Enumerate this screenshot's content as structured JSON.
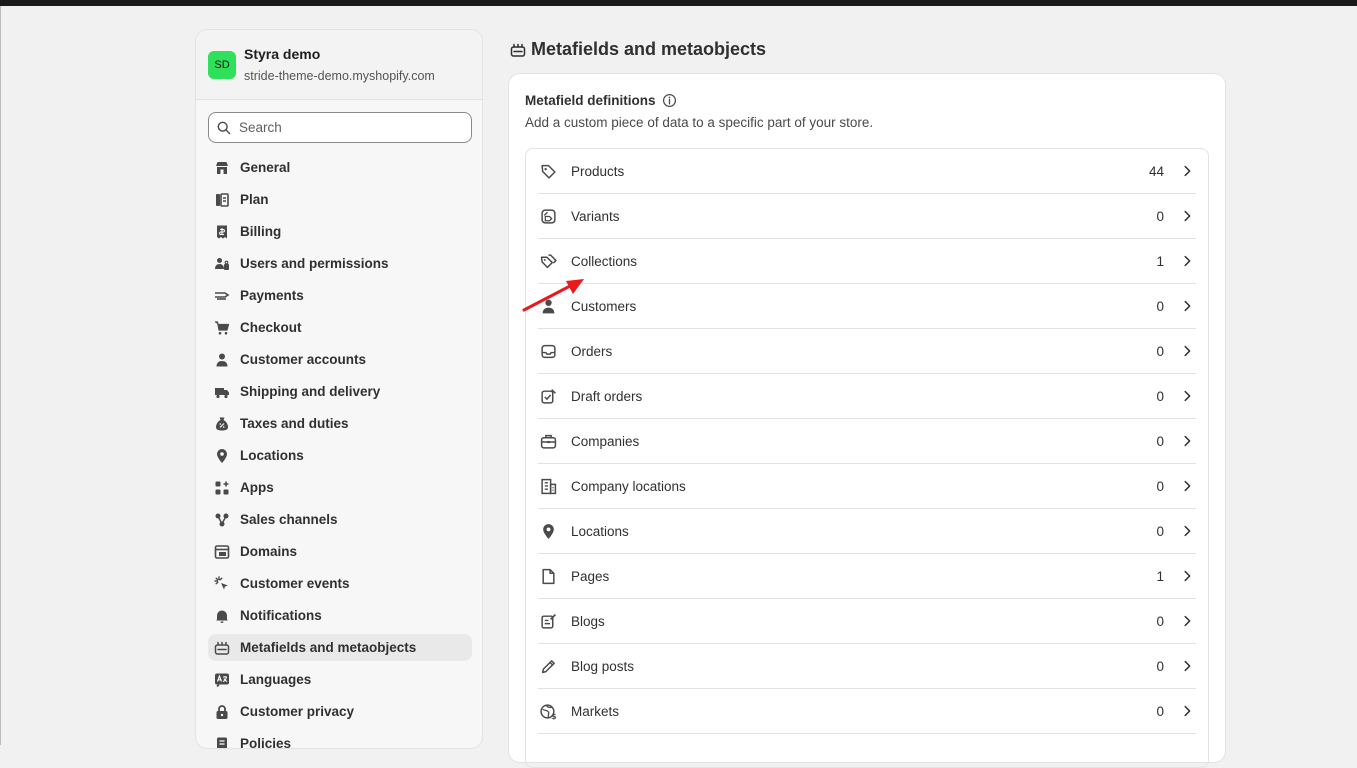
{
  "store": {
    "initials": "SD",
    "name": "Styra demo",
    "domain": "stride-theme-demo.myshopify.com",
    "avatar_color": "#2ee05a"
  },
  "search": {
    "placeholder": "Search",
    "value": ""
  },
  "sidebar": {
    "items": [
      {
        "label": "General",
        "icon": "store-icon"
      },
      {
        "label": "Plan",
        "icon": "plan-icon"
      },
      {
        "label": "Billing",
        "icon": "billing-icon"
      },
      {
        "label": "Users and permissions",
        "icon": "users-icon"
      },
      {
        "label": "Payments",
        "icon": "payments-icon"
      },
      {
        "label": "Checkout",
        "icon": "cart-icon"
      },
      {
        "label": "Customer accounts",
        "icon": "person-icon"
      },
      {
        "label": "Shipping and delivery",
        "icon": "truck-icon"
      },
      {
        "label": "Taxes and duties",
        "icon": "tax-icon"
      },
      {
        "label": "Locations",
        "icon": "location-pin-icon"
      },
      {
        "label": "Apps",
        "icon": "apps-icon"
      },
      {
        "label": "Sales channels",
        "icon": "sales-channels-icon"
      },
      {
        "label": "Domains",
        "icon": "domains-icon"
      },
      {
        "label": "Customer events",
        "icon": "cursor-click-icon"
      },
      {
        "label": "Notifications",
        "icon": "bell-icon"
      },
      {
        "label": "Metafields and metaobjects",
        "icon": "metafields-icon",
        "active": true
      },
      {
        "label": "Languages",
        "icon": "languages-icon"
      },
      {
        "label": "Customer privacy",
        "icon": "lock-icon"
      },
      {
        "label": "Policies",
        "icon": "policies-icon"
      }
    ]
  },
  "main": {
    "title": "Metafields and metaobjects",
    "card": {
      "heading": "Metafield definitions",
      "description": "Add a custom piece of data to a specific part of your store.",
      "rows": [
        {
          "label": "Products",
          "count": "44",
          "icon": "tag-icon"
        },
        {
          "label": "Variants",
          "count": "0",
          "icon": "variant-icon"
        },
        {
          "label": "Collections",
          "count": "1",
          "icon": "collection-icon"
        },
        {
          "label": "Customers",
          "count": "0",
          "icon": "person-icon"
        },
        {
          "label": "Orders",
          "count": "0",
          "icon": "inbox-icon"
        },
        {
          "label": "Draft orders",
          "count": "0",
          "icon": "draft-order-icon"
        },
        {
          "label": "Companies",
          "count": "0",
          "icon": "briefcase-icon"
        },
        {
          "label": "Company locations",
          "count": "0",
          "icon": "building-icon"
        },
        {
          "label": "Locations",
          "count": "0",
          "icon": "location-pin-icon"
        },
        {
          "label": "Pages",
          "count": "1",
          "icon": "page-icon"
        },
        {
          "label": "Blogs",
          "count": "0",
          "icon": "blog-icon"
        },
        {
          "label": "Blog posts",
          "count": "0",
          "icon": "pencil-icon"
        },
        {
          "label": "Markets",
          "count": "0",
          "icon": "globe-icon"
        },
        {
          "label": "",
          "count": "",
          "icon": ""
        }
      ]
    }
  },
  "colors": {
    "annotation_arrow": "#e8191f",
    "accent_green": "#2ee05a"
  }
}
